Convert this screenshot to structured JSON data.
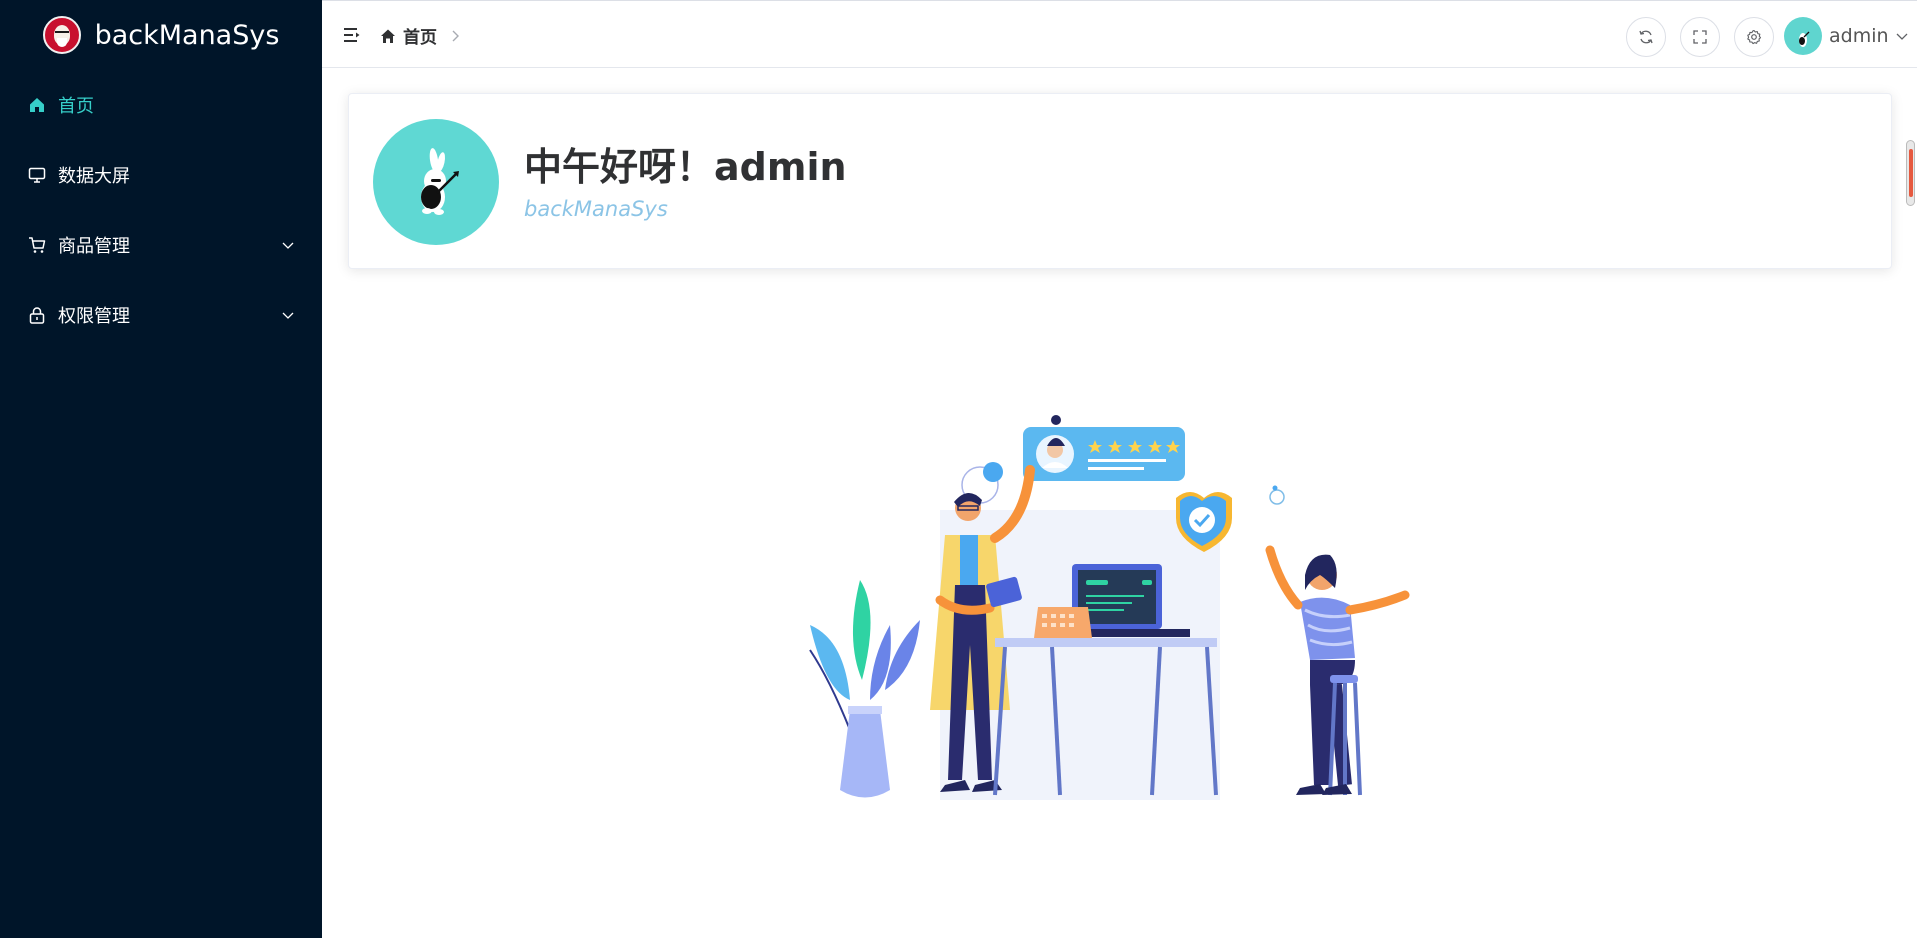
{
  "app": {
    "title": "backManaSys"
  },
  "sidebar": {
    "items": [
      {
        "label": "首页",
        "icon": "home-icon",
        "active": true,
        "has_children": false
      },
      {
        "label": "数据大屏",
        "icon": "monitor-icon",
        "active": false,
        "has_children": false
      },
      {
        "label": "商品管理",
        "icon": "cart-icon",
        "active": false,
        "has_children": true
      },
      {
        "label": "权限管理",
        "icon": "lock-icon",
        "active": false,
        "has_children": true
      }
    ]
  },
  "header": {
    "breadcrumb": [
      {
        "label": "首页",
        "icon": "home-icon"
      }
    ],
    "tools": [
      "refresh-icon",
      "fullscreen-icon",
      "settings-icon"
    ],
    "user": {
      "name": "admin"
    }
  },
  "welcome": {
    "greeting": "中午好呀！admin",
    "subtitle": "backManaSys"
  },
  "colors": {
    "sidebar_bg": "#001529",
    "accent": "#36cfc9",
    "subtitle": "#8bc4e6"
  }
}
